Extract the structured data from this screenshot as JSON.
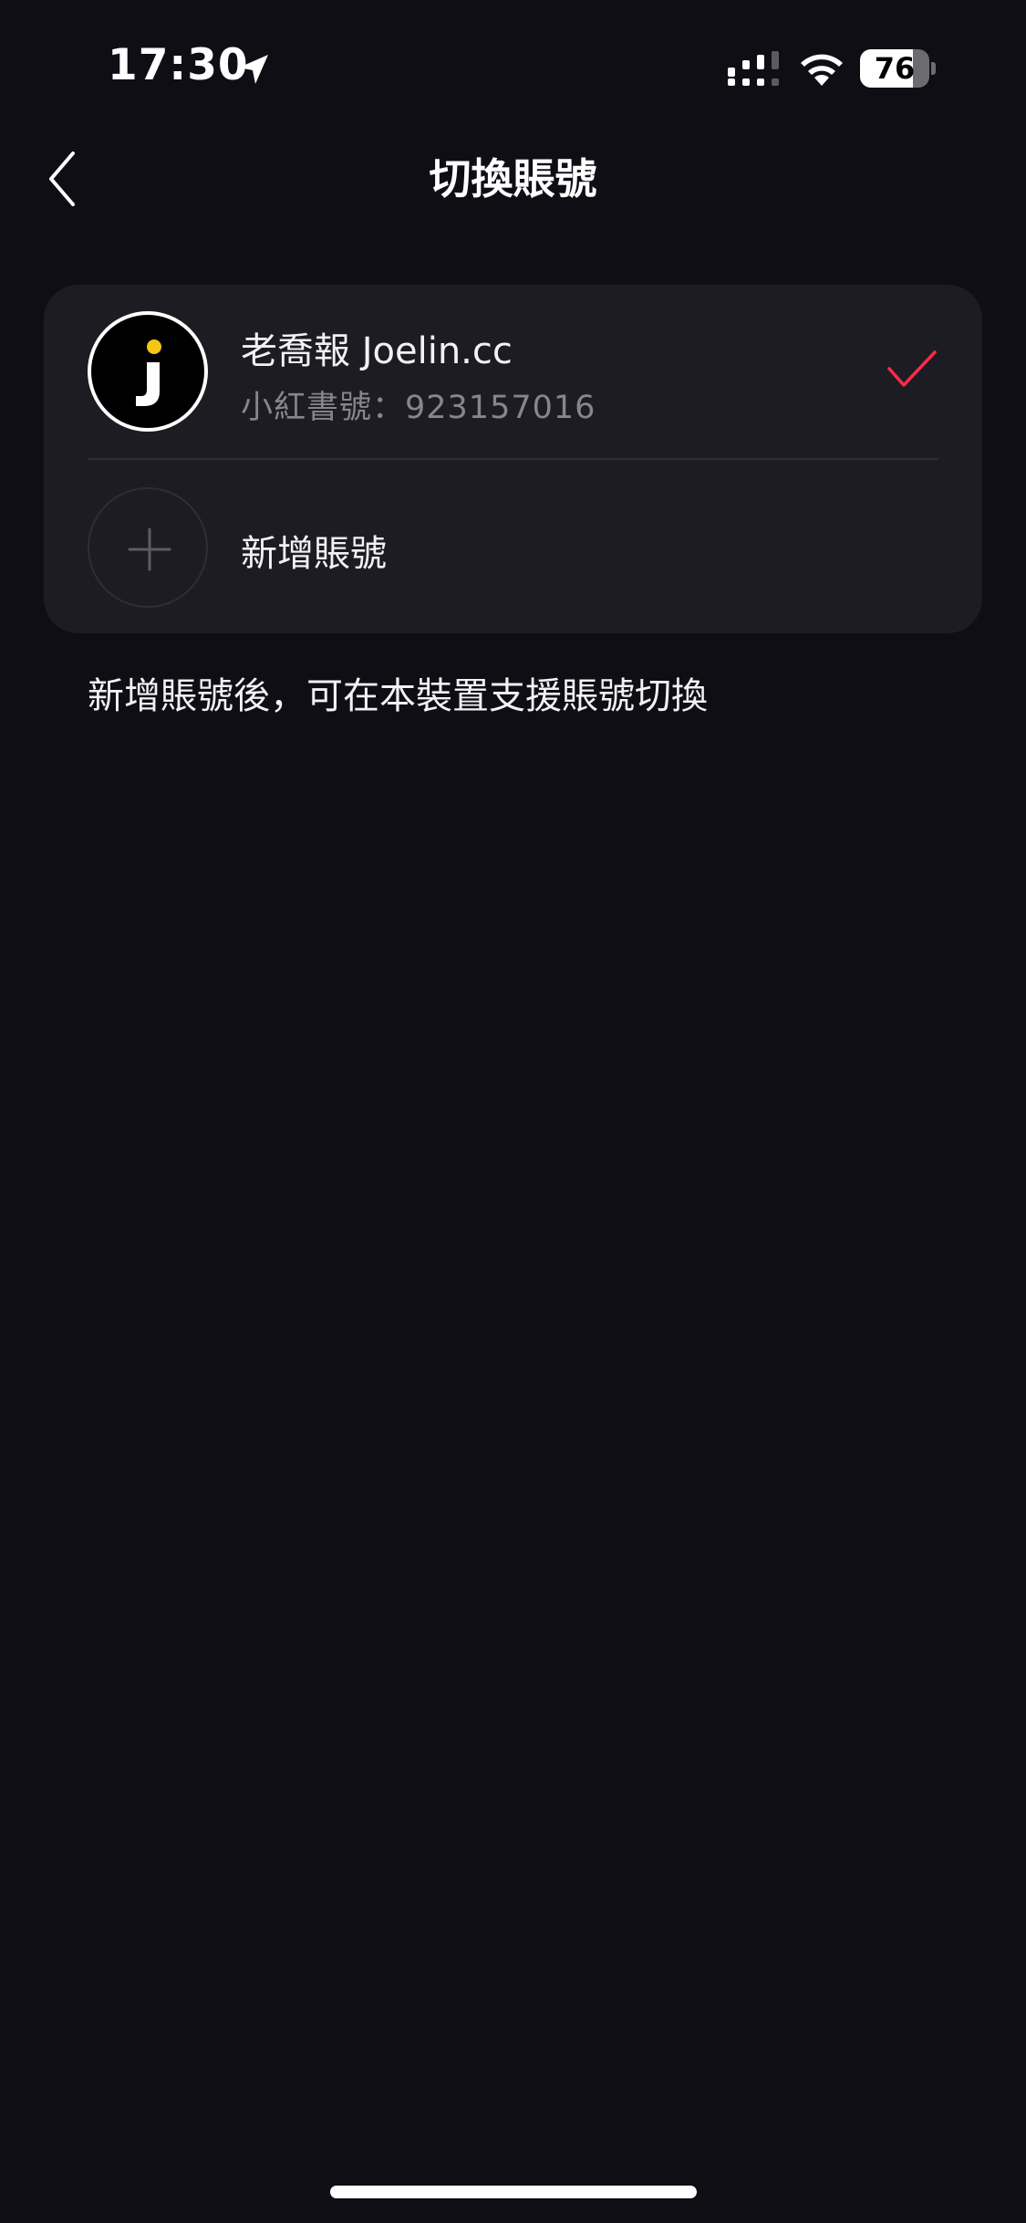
{
  "status_bar": {
    "time": "17:30",
    "battery_level": "76",
    "battery_fraction": 0.76,
    "icons": [
      "location-arrow-icon",
      "cellular-signal-icon",
      "wifi-icon",
      "battery-icon"
    ]
  },
  "nav": {
    "back_icon": "chevron-left-icon",
    "title": "切換賬號"
  },
  "accounts": [
    {
      "avatar_letter": "j",
      "name": "老喬報 Joelin.cc",
      "id_line": "小紅書號：923157016",
      "selected": true
    }
  ],
  "add_account": {
    "icon": "plus-icon",
    "label": "新增賬號"
  },
  "hint": "新增賬號後，可在本裝置支援賬號切換",
  "colors": {
    "background": "#0e0e14",
    "card": "#1c1c22",
    "check_accent": "#ff2a4a",
    "secondary_text": "#86868c",
    "avatar_dot": "#f5c518"
  }
}
